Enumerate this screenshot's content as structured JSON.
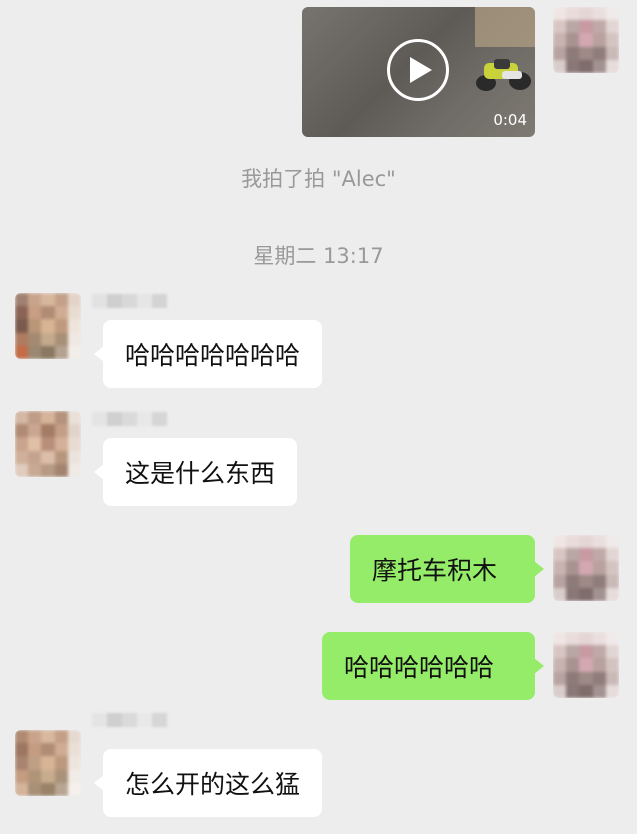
{
  "video": {
    "duration": "0:04"
  },
  "system_messages": {
    "pat": "我拍了拍 \"Alec\"",
    "timestamp": "星期二 13:17"
  },
  "messages": [
    {
      "side": "left",
      "text": "哈哈哈哈哈哈哈"
    },
    {
      "side": "left",
      "text": "这是什么东西"
    },
    {
      "side": "right",
      "text": "摩托车积木"
    },
    {
      "side": "right",
      "text": "哈哈哈哈哈哈"
    },
    {
      "side": "left",
      "text": "怎么开的这么猛"
    }
  ],
  "colors": {
    "background": "#ededed",
    "sent_bubble": "#95ec69",
    "received_bubble": "#ffffff",
    "system_text": "#999999"
  }
}
